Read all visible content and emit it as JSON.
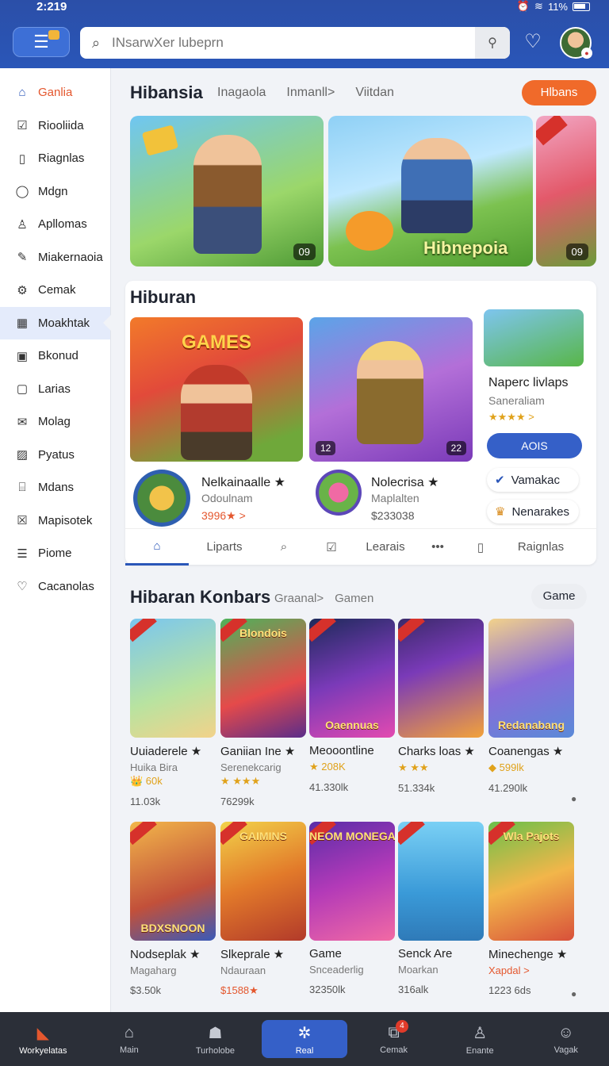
{
  "status": {
    "time": "2:219",
    "battery": "11%"
  },
  "search": {
    "placeholder": "INsarwXer lubeprn"
  },
  "sidebar": {
    "items": [
      {
        "label": "Ganlia",
        "icon": "home-icon"
      },
      {
        "label": "Riooliida",
        "icon": "check-icon"
      },
      {
        "label": "Riagnlas",
        "icon": "clipboard-icon"
      },
      {
        "label": "Mdgn",
        "icon": "location-icon"
      },
      {
        "label": "Apllomas",
        "icon": "user-icon"
      },
      {
        "label": "Miakernaoia",
        "icon": "edit-icon"
      },
      {
        "label": "Cemak",
        "icon": "gear-icon"
      },
      {
        "label": "Moakhtak",
        "icon": "grid-icon"
      },
      {
        "label": "Bkonud",
        "icon": "calendar-icon"
      },
      {
        "label": "Larias",
        "icon": "square-icon"
      },
      {
        "label": "Molag",
        "icon": "mail-icon"
      },
      {
        "label": "Pyatus",
        "icon": "image-icon"
      },
      {
        "label": "Mdans",
        "icon": "building-icon"
      },
      {
        "label": "Mapisotek",
        "icon": "checkbox-icon"
      },
      {
        "label": "Piome",
        "icon": "document-icon"
      },
      {
        "label": "Cacanolas",
        "icon": "heart-icon"
      }
    ]
  },
  "section1": {
    "title": "Hibansia",
    "tabs": [
      "Inagaola",
      "Inmanll>",
      "Viitdan"
    ],
    "button": "Hlbans",
    "banners": [
      {
        "label": "09"
      },
      {
        "label": "",
        "title": "Hibnepoia"
      },
      {
        "label": "09"
      }
    ]
  },
  "panel": {
    "title": "Hiburan",
    "tiles": [
      {
        "title": "GAMES",
        "num": "",
        "num2": ""
      },
      {
        "title": "",
        "num": "12",
        "num2": "22"
      }
    ],
    "side_card": {
      "title": "Naperc livlaps",
      "sub": "Saneraliam",
      "rating": "★★★★ >"
    },
    "aois_button": "AOIS",
    "mini1": "Vamakac",
    "mini2": "Nenarakes",
    "feat1": {
      "title": "Nelkainaalle ★",
      "sub": "Odoulnam",
      "price": "3996★ >"
    },
    "feat2": {
      "title": "Nolecrisa ★",
      "sub": "Maplalten",
      "price": "$233038"
    },
    "tabs": [
      "Liparts",
      "Learais",
      "Raignlas"
    ]
  },
  "section2": {
    "title": "Hibaran Konbars",
    "sub1": "Graanal>",
    "sub2": "Gamen",
    "pill": "Game",
    "row1": [
      {
        "name": "Uuiaderele ★",
        "sub": "Huika Bira",
        "rate": "👑 60k",
        "count": "11.03k",
        "art": ""
      },
      {
        "name": "Ganiian Ine ★",
        "sub": "Serenekcarig",
        "rate": "★ ★★★",
        "count": "76299k",
        "art": "Blondois"
      },
      {
        "name": "Meooontline",
        "sub": "",
        "rate": "★ 208K",
        "count": "41.330lk",
        "art": "Oaennuas"
      },
      {
        "name": "Charks loas ★",
        "sub": "",
        "rate": "★ ★★",
        "count": "51.334k",
        "art": ""
      },
      {
        "name": "Coanengas ★",
        "sub": "",
        "rate": "◆ 599lk",
        "count": "41.290lk",
        "art": "Redanabang"
      }
    ],
    "row2": [
      {
        "name": "Nodseplak ★",
        "sub": "Magaharg",
        "rate": "",
        "count": "$3.50k",
        "art": "BDXSNOON"
      },
      {
        "name": "Slkeprale ★",
        "sub": "Ndauraan",
        "rate": "",
        "count": "$1588★",
        "art": "GAIMINS"
      },
      {
        "name": "Game",
        "sub": "Snceaderlig",
        "rate": "",
        "count": "32350lk",
        "art": "NEOM MONEGAS"
      },
      {
        "name": "Senck Are",
        "sub": "Moarkan",
        "rate": "",
        "count": "316alk",
        "art": ""
      },
      {
        "name": "Minechenge ★",
        "sub": "Xapdal >",
        "rate": "",
        "count": "1223 6ds",
        "art": "Wla Pajots"
      }
    ]
  },
  "bottomnav": [
    {
      "label": "Workyelatas",
      "icon": "brand-logo-icon"
    },
    {
      "label": "Main",
      "icon": "home-icon"
    },
    {
      "label": "Turholobe",
      "icon": "person-icon",
      "badge": ""
    },
    {
      "label": "Real",
      "icon": "network-icon"
    },
    {
      "label": "Cemak",
      "icon": "share-icon",
      "badge": "4"
    },
    {
      "label": "Enante",
      "icon": "user-icon"
    },
    {
      "label": "Vagak",
      "icon": "profile-icon"
    }
  ]
}
